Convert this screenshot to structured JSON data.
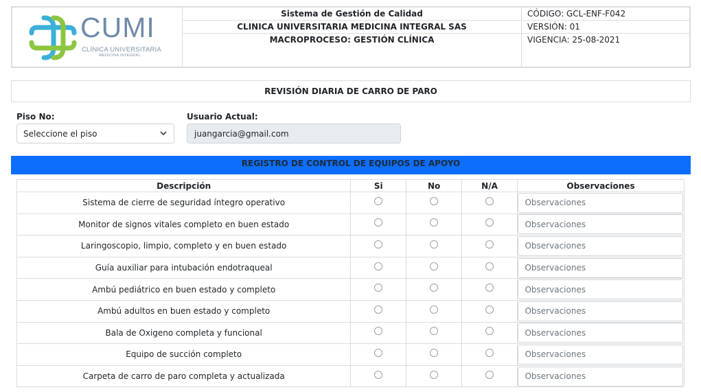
{
  "header": {
    "logo_word": "CUMI",
    "logo_sub1": "CLÍNICA UNIVERSITARIA",
    "logo_sub2": "MEDICINA INTEGRAL",
    "line1": "Sistema de Gestión de Calidad",
    "line2": "CLINICA UNIVERSITARIA MEDICINA INTEGRAL SAS",
    "line3": "MACROPROCESO: GESTIÓN CLÍNICA",
    "code": "CÓDIGO: GCL-ENF-F042",
    "version": "VERSIÓN: 01",
    "validity": "VIGENCIA: 25-08-2021",
    "logo_colors": {
      "blue": "#3bb0d8",
      "green": "#8cc63f",
      "text": "#6f8aa8"
    }
  },
  "form": {
    "title": "REVISIÓN DIARIA DE CARRO DE PARO",
    "floor_label": "Piso No:",
    "floor_value": "Seleccione el piso",
    "user_label": "Usuario Actual:",
    "user_value": "juangarcia@gmail.com"
  },
  "section": {
    "title": "REGISTRO DE CONTROL DE EQUIPOS DE APOYO",
    "color": "#0d6efd"
  },
  "table": {
    "headers": [
      "Descripción",
      "Si",
      "No",
      "N/A",
      "Observaciones"
    ],
    "obs_placeholder": "Observaciones",
    "rows": [
      "Sistema de cierre de seguridad íntegro operativo",
      "Monitor de signos vitales completo en buen estado",
      "Laringoscopio, limpio, completo y en buen estado",
      "Guía auxiliar para intubación endotraqueal",
      "Ambú pediátrico en buen estado y completo",
      "Ambú adultos en buen estado y completo",
      "Bala de Oxigeno completa y funcional",
      "Equipo de succión completo",
      "Carpeta de carro de paro completa y actualizada"
    ]
  }
}
